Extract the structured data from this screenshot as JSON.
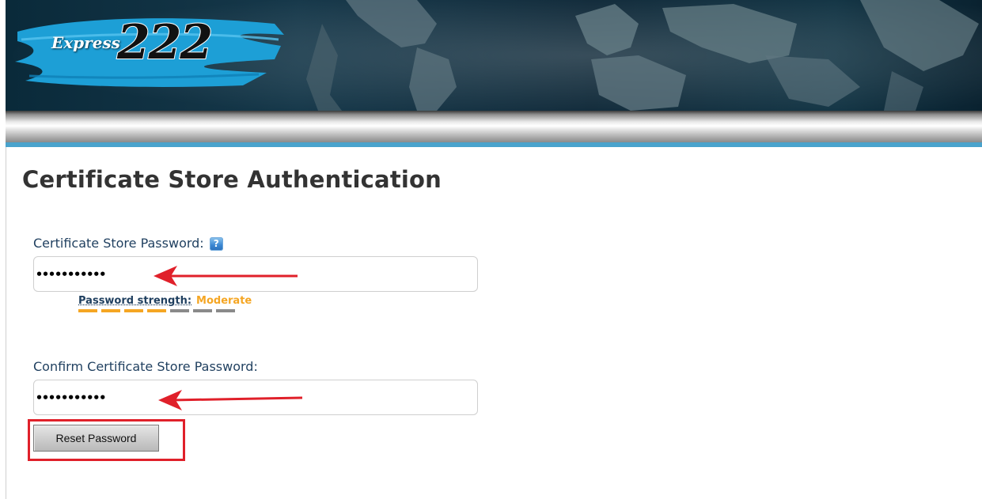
{
  "header": {
    "logo_small": "Express",
    "logo_big": "222"
  },
  "main": {
    "title": "Certificate Store Authentication",
    "password_field": {
      "label": "Certificate Store Password:",
      "value": "•••••••••••"
    },
    "strength": {
      "label": "Password strength:",
      "value": "Moderate",
      "filled_segments": 4,
      "total_segments": 7
    },
    "confirm_field": {
      "label": "Confirm Certificate Store Password:",
      "value": "•••••••••••"
    },
    "reset_button": {
      "label": "Reset Password"
    }
  },
  "icons": {
    "help": "help-icon",
    "annotation_arrow": "arrow-left-icon"
  },
  "colors": {
    "accent_blue": "#4aa3cc",
    "strength_moderate": "#f5a623",
    "annotation_red": "#e0202a",
    "label_text": "#1f3f5f",
    "title_text": "#333333"
  }
}
